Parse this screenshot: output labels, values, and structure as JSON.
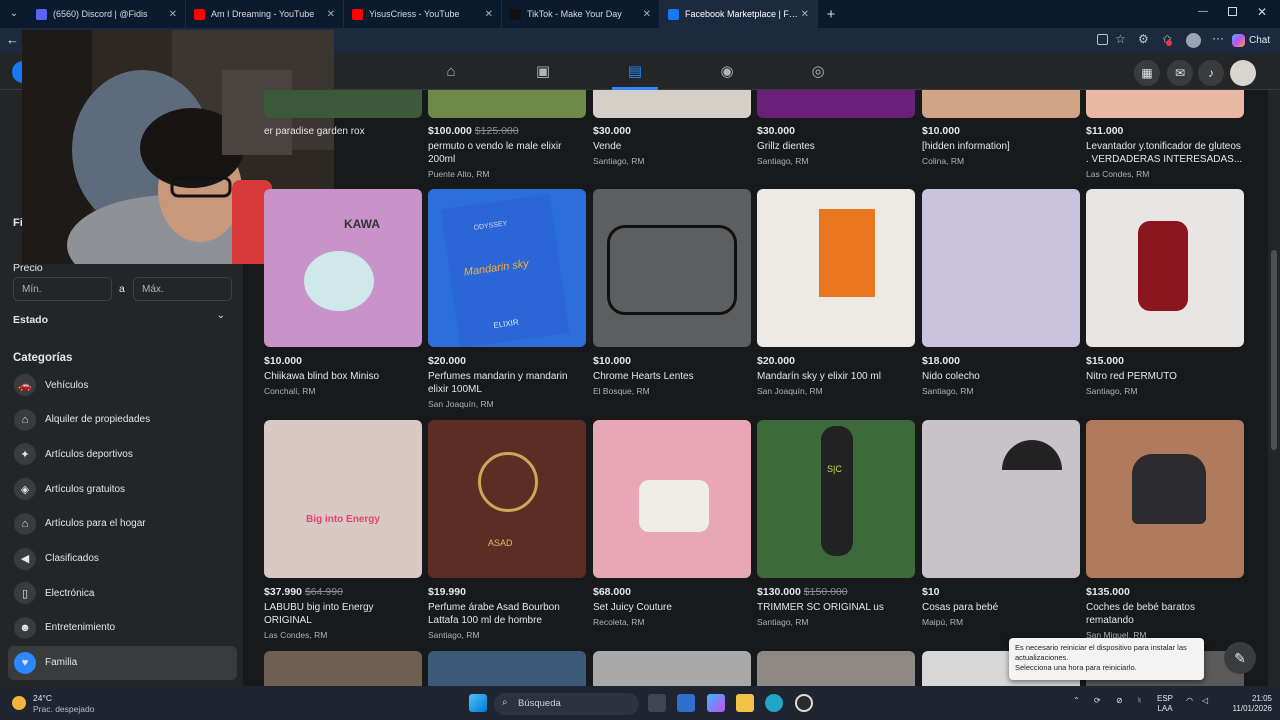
{
  "browser": {
    "tabs": [
      {
        "label": "(6560) Discord | @Fidis",
        "color": "#5865f2",
        "active": false
      },
      {
        "label": "Am I Dreaming - YouTube",
        "color": "#ff0000",
        "active": false
      },
      {
        "label": "YisusCriess - YouTube",
        "color": "#ff0000",
        "active": false
      },
      {
        "label": "TikTok - Make Your Day",
        "color": "#111111",
        "active": false
      },
      {
        "label": "Facebook Marketplace | Facebook",
        "color": "#1877f2",
        "active": true
      }
    ],
    "new_tab": "+",
    "chat_label": "Chat"
  },
  "sidebar": {
    "filters_partial": "Fil",
    "price_label": "Precio",
    "min_placeholder": "Mín.",
    "max_placeholder": "Máx.",
    "separator": "a",
    "state_label": "Estado",
    "categories_heading": "Categorías",
    "categories": [
      {
        "label": "Vehículos",
        "icon": "car-icon"
      },
      {
        "label": "Alquiler de propiedades",
        "icon": "house-icon"
      },
      {
        "label": "Artículos deportivos",
        "icon": "sports-icon"
      },
      {
        "label": "Artículos gratuitos",
        "icon": "tag-icon"
      },
      {
        "label": "Artículos para el hogar",
        "icon": "home-icon"
      },
      {
        "label": "Clasificados",
        "icon": "megaphone-icon"
      },
      {
        "label": "Electrónica",
        "icon": "phone-icon"
      },
      {
        "label": "Entretenimiento",
        "icon": "people-icon"
      },
      {
        "label": "Familia",
        "icon": "heart-icon"
      }
    ]
  },
  "listings_top": [
    {
      "price": "",
      "old": "",
      "title": "er paradise garden rox",
      "loc": ""
    },
    {
      "price": "$100.000",
      "old": "$125.000",
      "title": "permuto o vendo le male elixir 200ml",
      "loc": "Puente Alto, RM"
    },
    {
      "price": "$30.000",
      "old": "",
      "title": "Vende",
      "loc": "Santiago, RM"
    },
    {
      "price": "$30.000",
      "old": "",
      "title": "Grillz dientes",
      "loc": "Santiago, RM"
    },
    {
      "price": "$10.000",
      "old": "",
      "title": "[hidden information]",
      "loc": "Colina, RM"
    },
    {
      "price": "$11.000",
      "old": "",
      "title": "Levantador y.tonificador de gluteos . VERDADERAS INTERESADAS...",
      "loc": "Las Condes, RM"
    }
  ],
  "listings_row2": [
    {
      "price": "$10.000",
      "old": "",
      "title": "Chiikawa blind box Miniso",
      "loc": "Conchalí, RM"
    },
    {
      "price": "$20.000",
      "old": "",
      "title": "Perfumes mandarin y mandarin elixir 100ML",
      "loc": "San Joaquín, RM"
    },
    {
      "price": "$10.000",
      "old": "",
      "title": "Chrome Hearts Lentes",
      "loc": "El Bosque, RM"
    },
    {
      "price": "$20.000",
      "old": "",
      "title": "Mandarín sky y elixir 100 ml",
      "loc": "San Joaquín, RM"
    },
    {
      "price": "$18.000",
      "old": "",
      "title": "Nido colecho",
      "loc": "Santiago, RM"
    },
    {
      "price": "$15.000",
      "old": "",
      "title": "Nitro red PERMUTO",
      "loc": "Santiago, RM"
    }
  ],
  "listings_row3": [
    {
      "price": "$37.990",
      "old": "$64.990",
      "title": "LABUBU big into Energy ORIGINAL",
      "loc": "Las Condes, RM"
    },
    {
      "price": "$19.990",
      "old": "",
      "title": "Perfume árabe Asad Bourbon Lattafa 100 ml de hombre",
      "loc": "Santiago, RM"
    },
    {
      "price": "$68.000",
      "old": "",
      "title": "Set Juicy Couture",
      "loc": "Recoleta, RM"
    },
    {
      "price": "$130.000",
      "old": "$150.000",
      "title": "TRIMMER SC ORIGINAL us",
      "loc": "Santiago, RM"
    },
    {
      "price": "$10",
      "old": "",
      "title": "Cosas para bebé",
      "loc": "Maipú, RM"
    },
    {
      "price": "$135.000",
      "old": "",
      "title": "Coches de bebé baratos rematando",
      "loc": "San Miguel, RM"
    }
  ],
  "image_labels": {
    "kawa": "KAWA",
    "odyssey": "ODYSSEY",
    "mandarin": "Mandarin sky",
    "elixir": "ELIXIR",
    "big_into": "Big into Energy",
    "asad": "ASAD",
    "sc": "S|C"
  },
  "toast": {
    "line1": "Es necesario reiniciar el dispositivo para instalar las actualizaciones.",
    "line2": "Selecciona una hora para reiniciarlo."
  },
  "taskbar": {
    "weather_temp": "24°C",
    "weather_desc": "Prac. despejado",
    "search_placeholder": "Búsqueda",
    "lang1": "ESP",
    "lang2": "LAA",
    "time": "21:05",
    "date": "11/01/2026"
  }
}
